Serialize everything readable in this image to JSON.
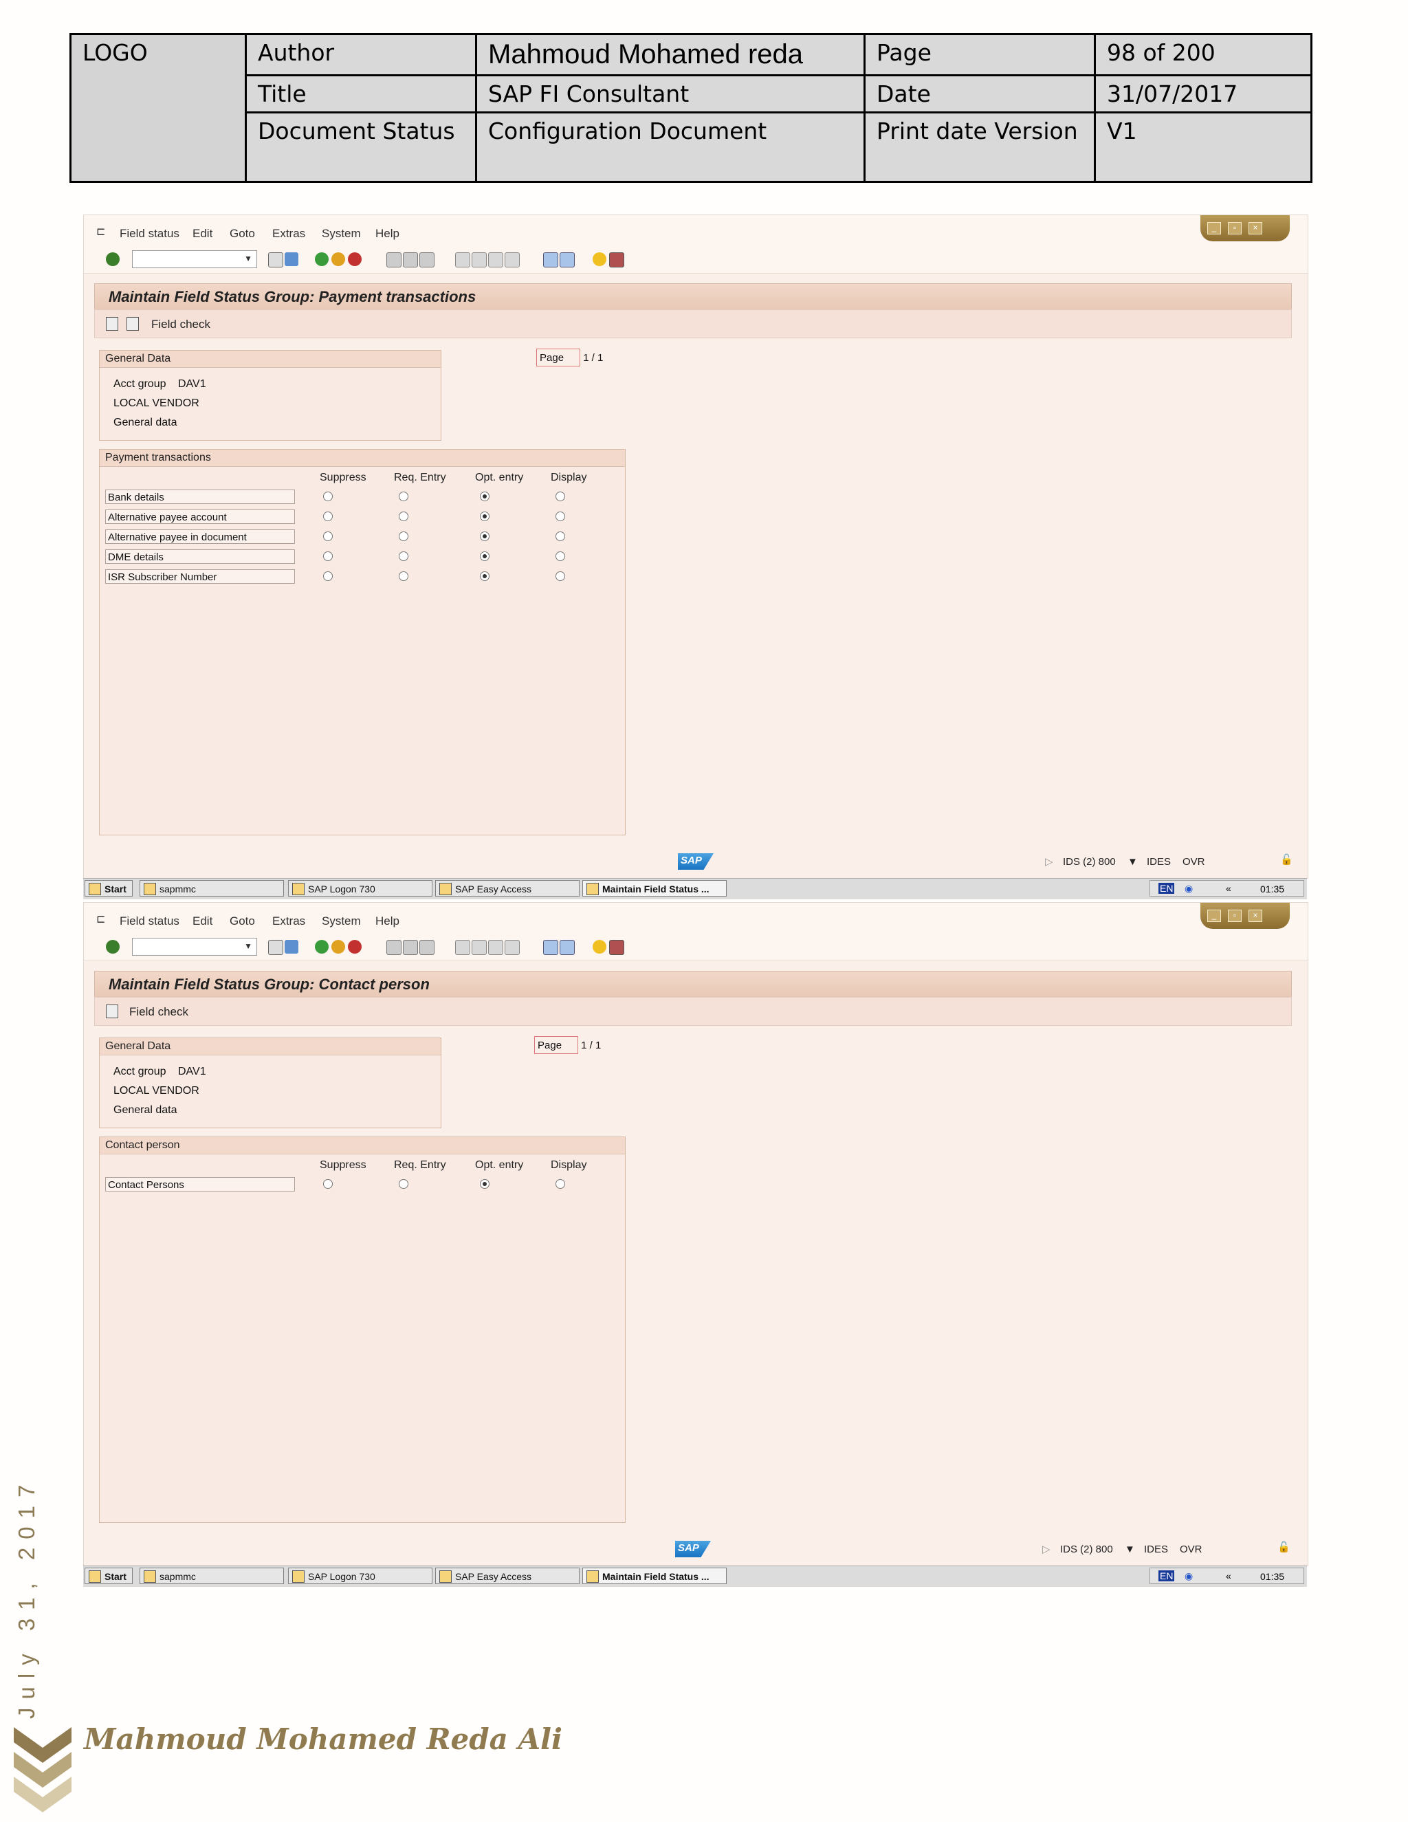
{
  "header": {
    "logo": "LOGO",
    "author_label": "Author",
    "author_value": "Mahmoud Mohamed reda",
    "page_label": "Page",
    "page_value": "98 of 200",
    "title_label": "Title",
    "title_value": "SAP FI Consultant",
    "date_label": "Date",
    "date_value": "31/07/2017",
    "status_label": "Document Status",
    "status_value": "Configuration Document",
    "print_label": "Print date Version",
    "version_value": "V1"
  },
  "menu": [
    "Field status",
    "Edit",
    "Goto",
    "Extras",
    "System",
    "Help"
  ],
  "screens": [
    {
      "title": "Maintain Field Status Group: Payment transactions",
      "field_check": "Field check",
      "general_header": "General Data",
      "acct_group_label": "Acct group",
      "acct_group_value": "DAV1",
      "vendor": "LOCAL VENDOR",
      "general_data": "General data",
      "page_label": "Page",
      "page_value": "1 / 1",
      "section": "Payment transactions",
      "columns": [
        "Suppress",
        "Req. Entry",
        "Opt. entry",
        "Display"
      ],
      "rows": [
        {
          "label": "Bank details",
          "selected": 2
        },
        {
          "label": "Alternative payee account",
          "selected": 2
        },
        {
          "label": "Alternative payee in document",
          "selected": 2
        },
        {
          "label": "DME details",
          "selected": 2
        },
        {
          "label": "ISR Subscriber Number",
          "selected": 2
        }
      ],
      "sap_logo": "SAP",
      "status_system": "IDS (2) 800",
      "status_server": "IDES",
      "status_mode": "OVR"
    },
    {
      "title": "Maintain Field Status Group: Contact person",
      "field_check": "Field check",
      "general_header": "General Data",
      "acct_group_label": "Acct group",
      "acct_group_value": "DAV1",
      "vendor": "LOCAL VENDOR",
      "general_data": "General data",
      "page_label": "Page",
      "page_value": "1 / 1",
      "section": "Contact person",
      "columns": [
        "Suppress",
        "Req. Entry",
        "Opt. entry",
        "Display"
      ],
      "rows": [
        {
          "label": "Contact Persons",
          "selected": 2
        }
      ],
      "sap_logo": "SAP",
      "status_system": "IDS (2) 800",
      "status_server": "IDES",
      "status_mode": "OVR"
    }
  ],
  "taskbar": {
    "start": "Start",
    "items": [
      "sapmmc",
      "SAP Logon 730",
      "SAP Easy Access",
      "Maintain Field Status ..."
    ],
    "lang": "EN",
    "time": "01:35"
  },
  "footer": {
    "vertical_date": "July 31, 2017",
    "signature": "Mahmoud Mohamed Reda Ali"
  },
  "colors": {
    "sap_bg": "#fbefea",
    "title_bar": "#ecd0c0",
    "footer_gold": "#8f7b4f",
    "header_gray": "#d9d9d9"
  }
}
